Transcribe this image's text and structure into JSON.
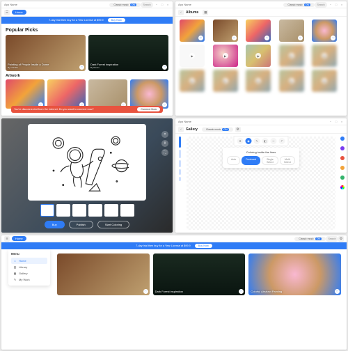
{
  "app": {
    "name": "App Name"
  },
  "trial": {
    "text": "7-day trial then buy for a Year License at $99.9",
    "buy": "Buy Now"
  },
  "music": {
    "label": "Classic music",
    "toggle": "ON"
  },
  "search": {
    "placeholder": "Search"
  },
  "home": {
    "tab": "Home",
    "popular_title": "Popular Picks",
    "artwork_title": "Artwork",
    "picks": [
      {
        "title": "Painting of People Inside a Dome",
        "by": "By utomilia"
      },
      {
        "title": "Dark Forest inspiration",
        "by": "By Ruvim"
      }
    ],
    "alert": {
      "text": "You're disconnected from the internet. Do you want to connect now?",
      "btn": "Connect Now"
    }
  },
  "albums": {
    "title": "Albums"
  },
  "editor3": {
    "buttons": {
      "buy": "Buy",
      "publish": "Publish",
      "start": "Start Coloring"
    }
  },
  "gallery": {
    "title": "Gallery",
    "popup_title": "Coloring inside the lines",
    "modes": {
      "auto": "Auto",
      "freehand": "Freehand",
      "single": "Single Select",
      "multi": "Multi Select"
    }
  },
  "menu": {
    "title": "Menu",
    "items": [
      {
        "label": "Home",
        "active": true
      },
      {
        "label": "Library",
        "active": false
      },
      {
        "label": "Gallery",
        "active": false
      },
      {
        "label": "My Work",
        "active": false
      }
    ]
  },
  "s5cards": [
    {
      "title": "Dark Forest inspiration"
    },
    {
      "title": "Colorful Abstract Painting"
    }
  ]
}
